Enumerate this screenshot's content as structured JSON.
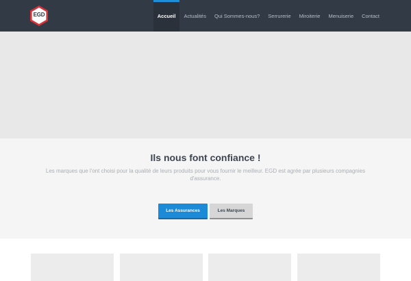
{
  "header": {
    "logo_text": "EGD",
    "logo_colors": {
      "outer": "#d8323a",
      "inner": "#ffffff"
    },
    "nav": [
      {
        "label": "Accueil",
        "active": true
      },
      {
        "label": "Actualités",
        "active": false
      },
      {
        "label": "Qui Sommes-nous?",
        "active": false
      },
      {
        "label": "Serrurerie",
        "active": false
      },
      {
        "label": "Miroiterie",
        "active": false
      },
      {
        "label": "Menuiserie",
        "active": false
      },
      {
        "label": "Contact",
        "active": false
      }
    ]
  },
  "trust": {
    "title": "Ils nous font confiance !",
    "description": "Les marques que l'ont choisi pour la qualité de leurs produits pour vous fournir le meilleur. EGD est agrée par plusieurs compagnies d'assurance.",
    "buttons": {
      "primary": "Les Assurances",
      "secondary": "Les Marques"
    }
  },
  "colors": {
    "header_bg": "#323a45",
    "accent": "#1c8ad6"
  }
}
